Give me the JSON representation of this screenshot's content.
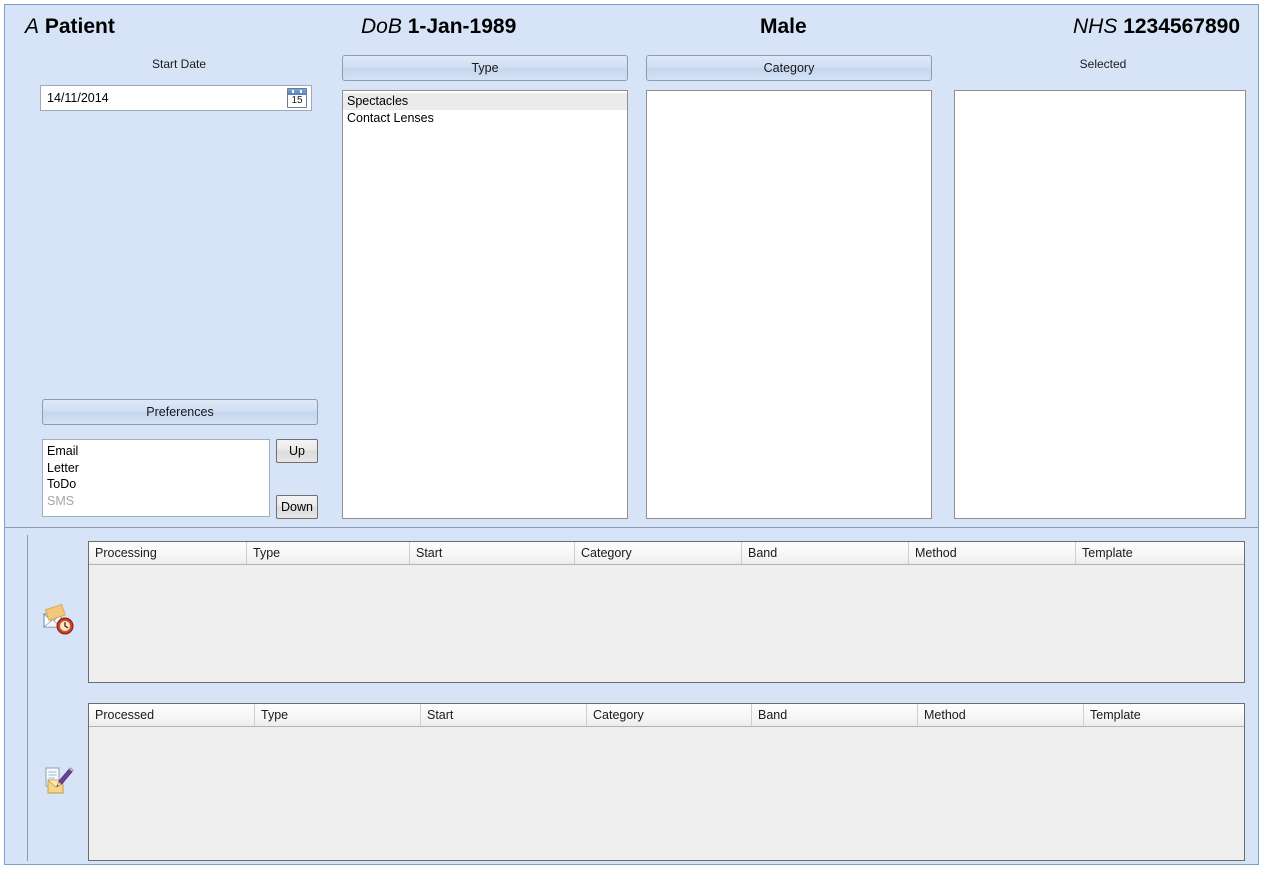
{
  "header": {
    "patient_prefix": "A",
    "patient_name": "Patient",
    "dob_label": "DoB",
    "dob_value": "1-Jan-1989",
    "sex": "Male",
    "nhs_label": "NHS",
    "nhs_value": "1234567890"
  },
  "start_date": {
    "caption": "Start Date",
    "value": "14/11/2014",
    "calendar_day": "15",
    "calendar_icon": "calendar-icon"
  },
  "type_panel": {
    "button_label": "Type",
    "items": [
      {
        "label": "Spectacles",
        "selected": true,
        "disabled": false
      },
      {
        "label": "Contact Lenses",
        "selected": false,
        "disabled": false
      }
    ]
  },
  "category_panel": {
    "button_label": "Category",
    "items": []
  },
  "selected_panel": {
    "caption": "Selected",
    "items": []
  },
  "preferences": {
    "button_label": "Preferences",
    "items": [
      {
        "label": "Email",
        "disabled": false
      },
      {
        "label": "Letter",
        "disabled": false
      },
      {
        "label": "ToDo",
        "disabled": false
      },
      {
        "label": "SMS",
        "disabled": true
      }
    ],
    "up_label": "Up",
    "down_label": "Down"
  },
  "processing_grid": {
    "icon": "envelope-clock-icon",
    "columns": [
      "Processing",
      "Type",
      "Start",
      "Category",
      "Band",
      "Method",
      "Template"
    ],
    "rows": []
  },
  "processed_grid": {
    "icon": "document-pencil-icon",
    "columns": [
      "Processed",
      "Type",
      "Start",
      "Category",
      "Band",
      "Method",
      "Template"
    ],
    "rows": []
  },
  "colors": {
    "window_background": "#d7e4f7",
    "window_border": "#7ba0d0",
    "grid_body": "#efefef",
    "grid_border": "#6c6c6c",
    "list_selection": "#ebebeb",
    "disabled_text": "#a6a6a6"
  }
}
